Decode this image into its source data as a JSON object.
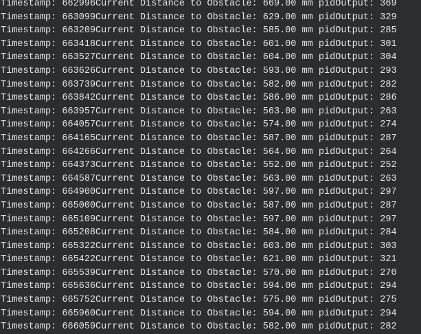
{
  "console": {
    "lines": [
      "Timestamp: 662996Current Distance to Obstacle: 669.00 mm pidOutput: 369",
      "Timestamp: 663099Current Distance to Obstacle: 629.00 mm pidOutput: 329",
      "Timestamp: 663209Current Distance to Obstacle: 585.00 mm pidOutput: 285",
      "Timestamp: 663418Current Distance to Obstacle: 601.00 mm pidOutput: 301",
      "Timestamp: 663527Current Distance to Obstacle: 604.00 mm pidOutput: 304",
      "Timestamp: 663626Current Distance to Obstacle: 593.00 mm pidOutput: 293",
      "Timestamp: 663739Current Distance to Obstacle: 582.00 mm pidOutput: 282",
      "Timestamp: 663842Current Distance to Obstacle: 586.00 mm pidOutput: 286",
      "Timestamp: 663957Current Distance to Obstacle: 563.00 mm pidOutput: 263",
      "Timestamp: 664057Current Distance to Obstacle: 574.00 mm pidOutput: 274",
      "Timestamp: 664165Current Distance to Obstacle: 587.00 mm pidOutput: 287",
      "Timestamp: 664266Current Distance to Obstacle: 564.00 mm pidOutput: 264",
      "Timestamp: 664373Current Distance to Obstacle: 552.00 mm pidOutput: 252",
      "Timestamp: 664587Current Distance to Obstacle: 563.00 mm pidOutput: 263",
      "Timestamp: 664900Current Distance to Obstacle: 597.00 mm pidOutput: 297",
      "Timestamp: 665000Current Distance to Obstacle: 587.00 mm pidOutput: 287",
      "Timestamp: 665109Current Distance to Obstacle: 597.00 mm pidOutput: 297",
      "Timestamp: 665208Current Distance to Obstacle: 584.00 mm pidOutput: 284",
      "Timestamp: 665322Current Distance to Obstacle: 603.00 mm pidOutput: 303",
      "Timestamp: 665422Current Distance to Obstacle: 621.00 mm pidOutput: 321",
      "Timestamp: 665539Current Distance to Obstacle: 570.00 mm pidOutput: 270",
      "Timestamp: 665636Current Distance to Obstacle: 594.00 mm pidOutput: 294",
      "Timestamp: 665752Current Distance to Obstacle: 575.00 mm pidOutput: 275",
      "Timestamp: 665960Current Distance to Obstacle: 594.00 mm pidOutput: 294",
      "Timestamp: 666059Current Distance to Obstacle: 582.00 mm pidOutput: 282"
    ]
  },
  "colors": {
    "background": "#2b2d30",
    "text": "#e6e6e6"
  }
}
